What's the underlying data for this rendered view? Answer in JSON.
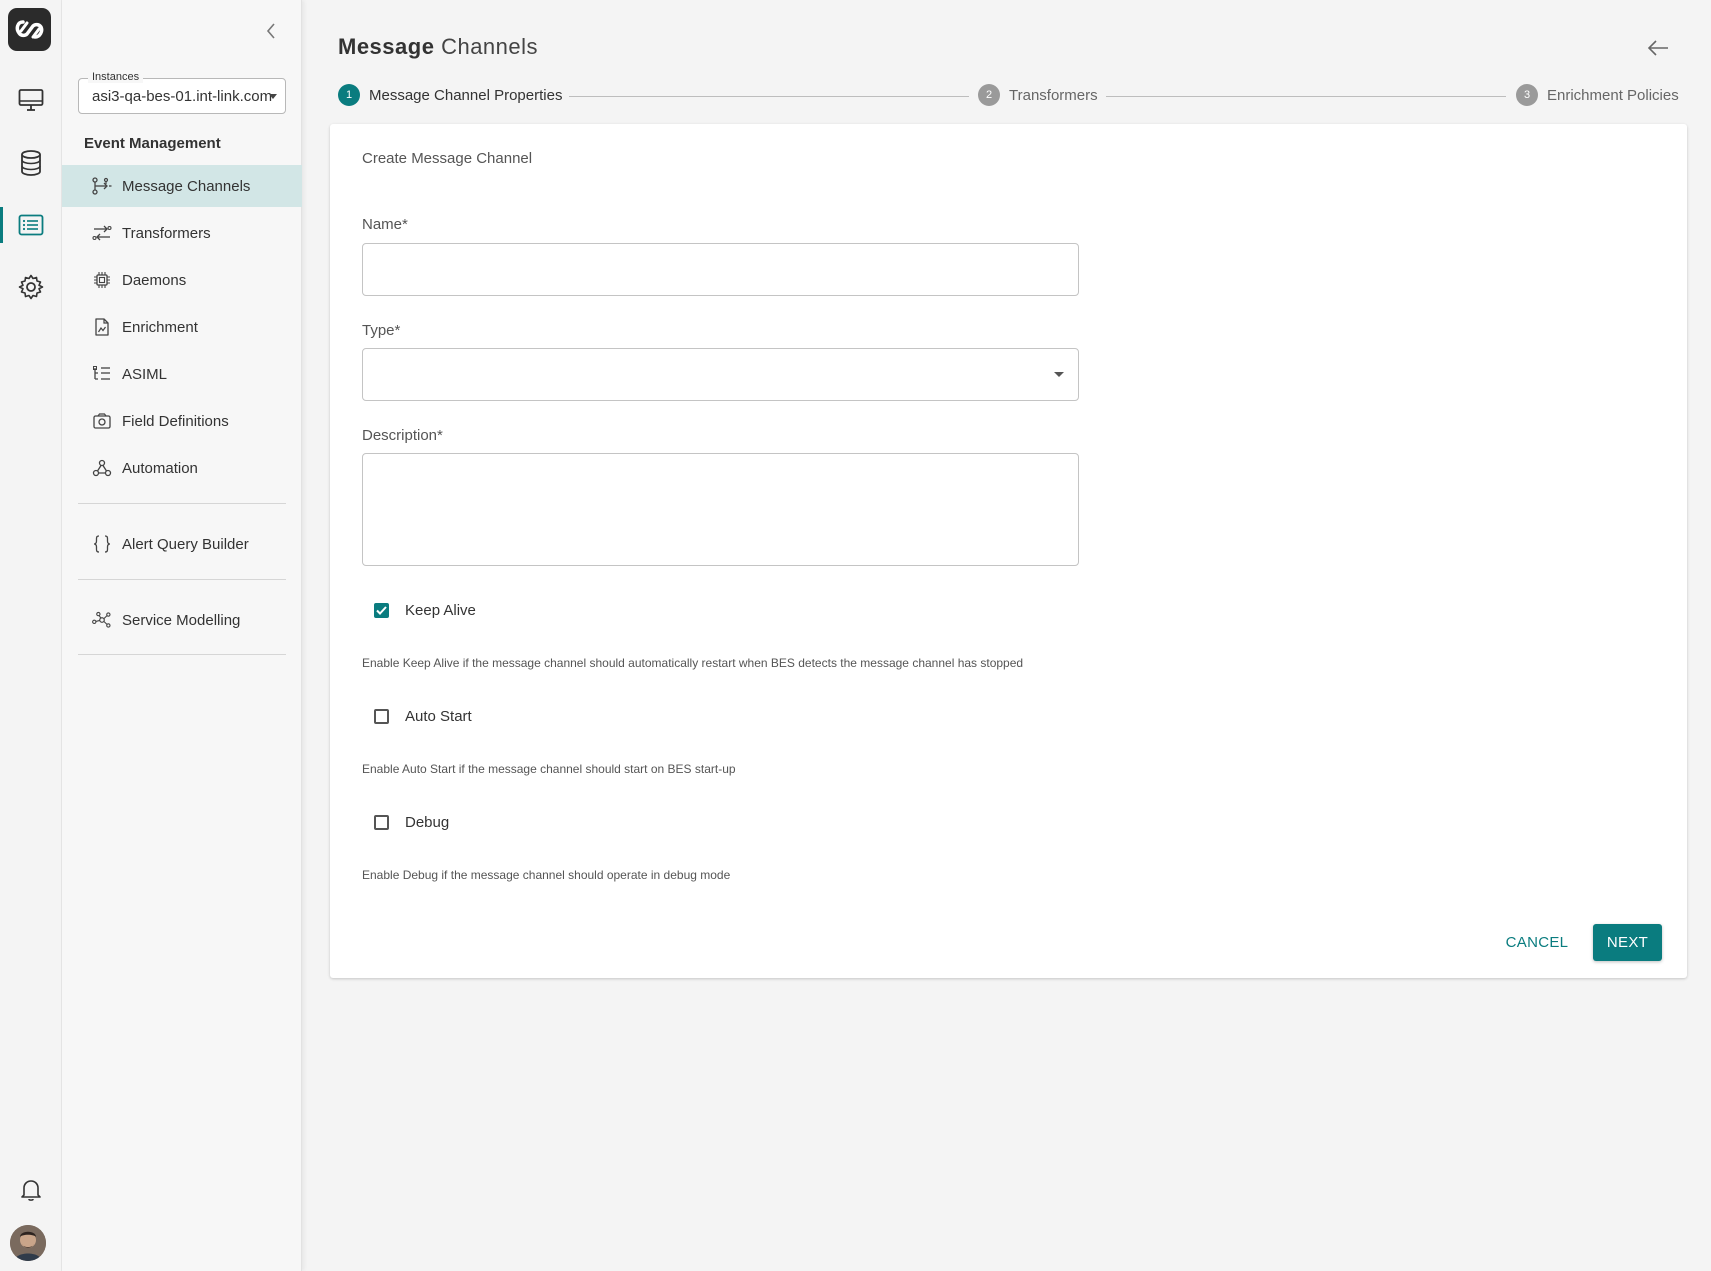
{
  "colors": {
    "accent": "#0a7c7f",
    "active_nav_bg": "#d2e6e6",
    "step_inactive": "#9a9a9a"
  },
  "rail": {
    "items": [
      {
        "name": "monitor-icon",
        "active": false
      },
      {
        "name": "database-icon",
        "active": false
      },
      {
        "name": "list-icon",
        "active": true
      },
      {
        "name": "gear-icon",
        "active": false
      }
    ],
    "bottom": [
      "bell-icon",
      "avatar"
    ]
  },
  "sidebar": {
    "instances": {
      "label": "Instances",
      "value": "asi3-qa-bes-01.int-link.com"
    },
    "section_title": "Event Management",
    "items": [
      {
        "label": "Message Channels",
        "icon": "channels-icon",
        "active": true
      },
      {
        "label": "Transformers",
        "icon": "transform-icon",
        "active": false
      },
      {
        "label": "Daemons",
        "icon": "chip-icon",
        "active": false
      },
      {
        "label": "Enrichment",
        "icon": "document-icon",
        "active": false
      },
      {
        "label": "ASIML",
        "icon": "tree-list-icon",
        "active": false
      },
      {
        "label": "Field Definitions",
        "icon": "camera-icon",
        "active": false
      },
      {
        "label": "Automation",
        "icon": "webhook-icon",
        "active": false
      },
      {
        "label": "Alert Query Builder",
        "icon": "braces-icon",
        "active": false
      },
      {
        "label": "Service Modelling",
        "icon": "network-icon",
        "active": false
      }
    ]
  },
  "header": {
    "title_bold": "Message",
    "title_rest": "Channels"
  },
  "stepper": {
    "steps": [
      {
        "num": "1",
        "label": "Message Channel Properties",
        "active": true
      },
      {
        "num": "2",
        "label": "Transformers",
        "active": false
      },
      {
        "num": "3",
        "label": "Enrichment Policies",
        "active": false
      }
    ]
  },
  "form": {
    "title": "Create Message Channel",
    "name_label": "Name*",
    "name_value": "",
    "type_label": "Type*",
    "type_value": "",
    "description_label": "Description*",
    "description_value": "",
    "keep_alive": {
      "label": "Keep Alive",
      "checked": true,
      "help": "Enable Keep Alive if the message channel should automatically restart when BES detects the message channel has stopped"
    },
    "auto_start": {
      "label": "Auto Start",
      "checked": false,
      "help": "Enable Auto Start if the message channel should start on BES start-up"
    },
    "debug": {
      "label": "Debug",
      "checked": false,
      "help": "Enable Debug if the message channel should operate in debug mode"
    },
    "cancel_label": "CANCEL",
    "next_label": "NEXT"
  }
}
